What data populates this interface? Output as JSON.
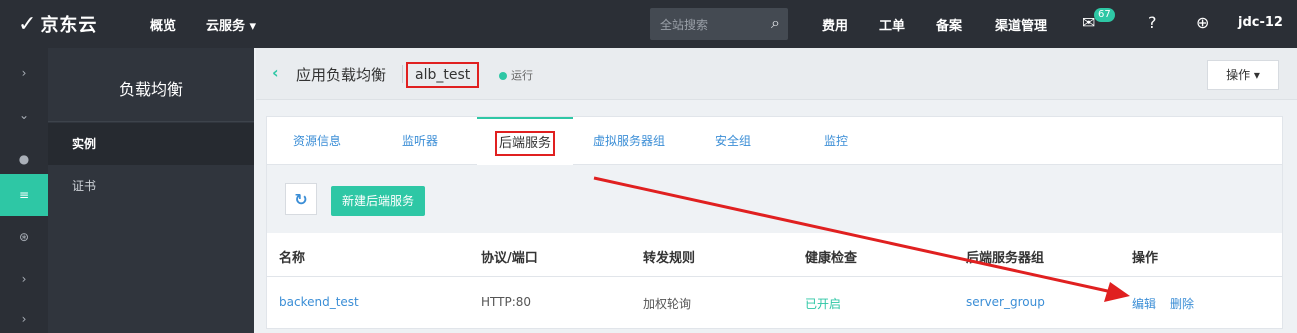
{
  "topbar": {
    "brand": "京东云",
    "nav": [
      "概览",
      "云服务 ▾"
    ],
    "search_placeholder": "全站搜索",
    "right_nav": [
      "费用",
      "工单",
      "备案",
      "渠道管理"
    ],
    "mail_badge": "67",
    "user": "jdc-12"
  },
  "rail": {
    "icons": [
      "chevron-right-icon",
      "chevron-down-icon",
      "globe-icon",
      "sliders-icon",
      "network-icon",
      "chevron-right-icon",
      "chevron-right-icon"
    ]
  },
  "sidepanel": {
    "title": "负载均衡",
    "items": [
      {
        "label": "实例",
        "active": true
      },
      {
        "label": "证书",
        "active": false
      }
    ]
  },
  "header": {
    "crumb": "应用负载均衡",
    "instance_name": "alb_test",
    "status": "运行",
    "ops_button": "操作 ▾"
  },
  "tabs": [
    {
      "label": "资源信息"
    },
    {
      "label": "监听器"
    },
    {
      "label": "后端服务",
      "active": true
    },
    {
      "label": "虚拟服务器组"
    },
    {
      "label": "安全组"
    },
    {
      "label": "监控"
    }
  ],
  "toolbar": {
    "new_button": "新建后端服务"
  },
  "table": {
    "columns": [
      "名称",
      "协议/端口",
      "转发规则",
      "健康检查",
      "后端服务器组",
      "操作"
    ],
    "rows": [
      {
        "name": "backend_test",
        "protocol_port": "HTTP:80",
        "rule": "加权轮询",
        "health": "已开启",
        "server_group": "server_group",
        "actions": [
          "编辑",
          "删除"
        ]
      }
    ]
  },
  "colors": {
    "accent": "#2ec7a5",
    "link": "#3b8ed6",
    "annotation": "#e02020"
  }
}
